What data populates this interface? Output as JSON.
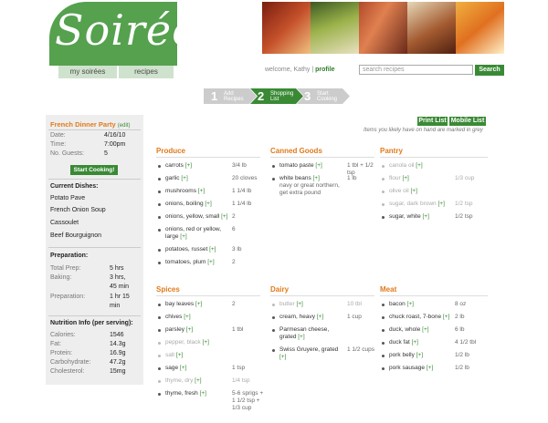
{
  "logo": {
    "text": "Soirée"
  },
  "nav": {
    "tab1": "my soirées",
    "tab2": "recipes"
  },
  "header": {
    "welcome": "welcome, Kathy |",
    "profile": "profile",
    "search_placeholder": "search recipes",
    "search_button": "Search"
  },
  "steps": [
    {
      "num": "1",
      "label": "Add Recipes"
    },
    {
      "num": "2",
      "label": "Shopping List"
    },
    {
      "num": "3",
      "label": "Start Cooking"
    }
  ],
  "sidebar": {
    "party_title": "French Dinner Party",
    "edit": "(edit)",
    "date_label": "Date:",
    "date": "4/16/10",
    "time_label": "Time:",
    "time": "7:00pm",
    "guests_label": "No. Guests:",
    "guests": "5",
    "start_button": "Start Cooking!",
    "dishes_title": "Current Dishes:",
    "dishes": [
      "Potato Pave",
      "French Onion Soup",
      "Cassoulet",
      "Beef Bourguignon"
    ],
    "prep_title": "Preparation:",
    "total_prep_label": "Total Prep:",
    "total_prep": "5 hrs",
    "baking_label": "Baking:",
    "baking_1": "3 hrs,",
    "baking_2": "45 min",
    "preparation_label": "Preparation:",
    "preparation_1": "1 hr 15",
    "preparation_2": "min",
    "nutrition_title": "Nutrition Info (per serving):",
    "nutrition": [
      {
        "label": "Calories:",
        "value": "1546"
      },
      {
        "label": "Fat:",
        "value": "14.3g"
      },
      {
        "label": "Protein:",
        "value": "16.9g"
      },
      {
        "label": "Carbohydrate:",
        "value": "47.2g"
      },
      {
        "label": "Cholesterol:",
        "value": "15mg"
      }
    ]
  },
  "actions": {
    "print": "Print List",
    "mobile": "Mobile List",
    "note": "Items you likely have on hand are marked in grey"
  },
  "sections": {
    "produce": {
      "title": "Produce",
      "items": [
        {
          "name": "carrots",
          "qty": "3/4 lb",
          "grey": false
        },
        {
          "name": "garlic",
          "qty": "20 cloves",
          "grey": false
        },
        {
          "name": "mushrooms",
          "qty": "1 1/4 lb",
          "grey": false
        },
        {
          "name": "onions, boiling",
          "qty": "1 1/4 lb",
          "grey": false
        },
        {
          "name": "onions, yellow, small",
          "qty": "2",
          "grey": false
        },
        {
          "name": "onions, red or yellow, large",
          "qty": "6",
          "grey": false
        },
        {
          "name": "potatoes, russet",
          "qty": "3 lb",
          "grey": false
        },
        {
          "name": "tomatoes, plum",
          "qty": "2",
          "grey": false
        }
      ]
    },
    "canned": {
      "title": "Canned Goods",
      "items": [
        {
          "name": "tomato paste",
          "qty": "1 tbl + 1/2 tsp",
          "grey": false
        },
        {
          "name": "white beans",
          "sub": "navy or great northern, get extra pound",
          "qty": "1 lb",
          "grey": false
        }
      ]
    },
    "pantry": {
      "title": "Pantry",
      "items": [
        {
          "name": "canola oil",
          "qty": "",
          "grey": true
        },
        {
          "name": "flour",
          "qty": "1/3 cup",
          "grey": true
        },
        {
          "name": "olive oil",
          "qty": "",
          "grey": true
        },
        {
          "name": "sugar, dark brown",
          "qty": "1/2 tsp",
          "grey": true
        },
        {
          "name": "sugar, white",
          "qty": "1/2 tsp",
          "grey": false
        }
      ]
    },
    "spices": {
      "title": "Spices",
      "items": [
        {
          "name": "bay leaves",
          "qty": "2",
          "grey": false
        },
        {
          "name": "chives",
          "qty": "",
          "grey": false
        },
        {
          "name": "parsley",
          "qty": "1 tbl",
          "grey": false
        },
        {
          "name": "pepper, black",
          "qty": "",
          "grey": true
        },
        {
          "name": "salt",
          "qty": "",
          "grey": true
        },
        {
          "name": "sage",
          "qty": "1 tsp",
          "grey": false
        },
        {
          "name": "thyme, dry",
          "qty": "1/4 tsp",
          "grey": true
        },
        {
          "name": "thyme, fresh",
          "qty": "5-6 sprigs + 1 1/2 tsp + 1/3 cup",
          "grey": false
        }
      ]
    },
    "dairy": {
      "title": "Dairy",
      "items": [
        {
          "name": "butter",
          "qty": "10 tbl",
          "grey": true
        },
        {
          "name": "cream, heavy",
          "qty": "1 cup",
          "grey": false
        },
        {
          "name": "Parmesan cheese, grated",
          "qty": "",
          "grey": false
        },
        {
          "name": "Swiss Gruyere, grated",
          "qty": "1 1/2 cups",
          "grey": false
        }
      ]
    },
    "meat": {
      "title": "Meat",
      "items": [
        {
          "name": "bacon",
          "qty": "8 oz",
          "grey": false
        },
        {
          "name": "chuck roast, 7-bone",
          "qty": "2 lb",
          "grey": false
        },
        {
          "name": "duck, whole",
          "qty": "6 lb",
          "grey": false
        },
        {
          "name": "duck fat",
          "qty": "4 1/2 tbl",
          "grey": false
        },
        {
          "name": "pork belly",
          "qty": "1/2 lb",
          "grey": false
        },
        {
          "name": "pork sausage",
          "qty": "1/2 lb",
          "grey": false
        }
      ]
    }
  },
  "plus_label": "[+]",
  "colors": {
    "green": "#3a8a35",
    "orange": "#e07a1a",
    "grey_text": "#aaaaaa"
  }
}
